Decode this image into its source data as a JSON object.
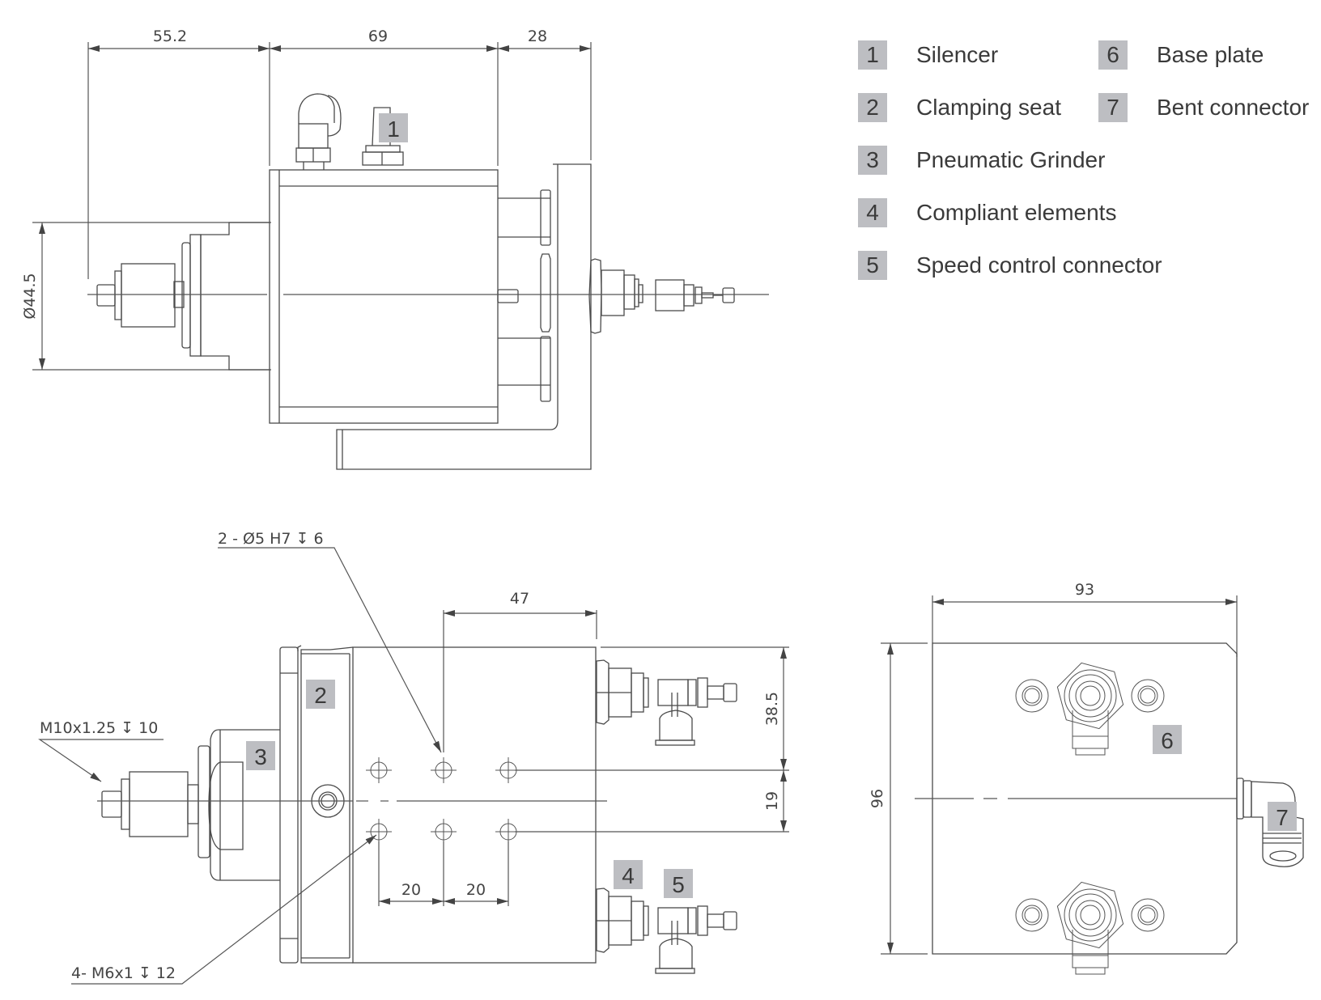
{
  "legend": {
    "items": [
      {
        "number": "1",
        "label": "Silencer"
      },
      {
        "number": "2",
        "label": "Clamping seat"
      },
      {
        "number": "3",
        "label": "Pneumatic Grinder"
      },
      {
        "number": "4",
        "label": "Compliant elements"
      },
      {
        "number": "5",
        "label": "Speed control connector"
      },
      {
        "number": "6",
        "label": "Base plate"
      },
      {
        "number": "7",
        "label": "Bent connector"
      }
    ]
  },
  "side_view": {
    "dimensions": {
      "tool_extension": "55.2",
      "body_length": "69",
      "bracket_depth": "28",
      "diameter": "Ø44.5"
    },
    "badges": [
      "1"
    ]
  },
  "top_view": {
    "dimensions": {
      "pin_offset": "47",
      "top_to_hole_row": "38.5",
      "hole_row_spacing": "19",
      "hole_pitch_1": "20",
      "hole_pitch_2": "20"
    },
    "callouts": {
      "dowel_holes": "2 - Ø5 H7 ↧ 6",
      "spindle_thread": "M10x1.25  ↧ 10",
      "tapped_holes": "4- M6x1  ↧ 12"
    },
    "badges": [
      "2",
      "3",
      "4",
      "5"
    ]
  },
  "end_view": {
    "dimensions": {
      "width": "93",
      "height": "96"
    },
    "badges": [
      "6",
      "7"
    ]
  }
}
